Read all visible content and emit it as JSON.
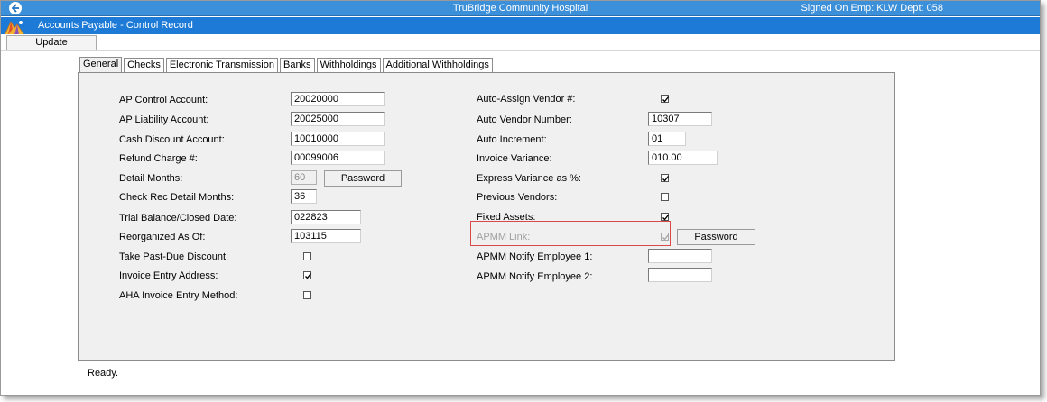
{
  "titlebar": {
    "hospital": "TruBridge Community Hospital",
    "signed_on": "Signed On Emp: KLW  Dept: 058"
  },
  "subbar": {
    "title": "Accounts Payable - Control Record"
  },
  "menu": {
    "update": "Update"
  },
  "tabs": [
    "General",
    "Checks",
    "Electronic Transmission",
    "Banks",
    "Withholdings",
    "Additional Withholdings"
  ],
  "left": {
    "ap_control_account": {
      "label": "AP Control Account:",
      "value": "20020000"
    },
    "ap_liability_account": {
      "label": "AP Liability Account:",
      "value": "20025000"
    },
    "cash_discount_account": {
      "label": "Cash Discount Account:",
      "value": "10010000"
    },
    "refund_charge": {
      "label": "Refund Charge #:",
      "value": "00099006"
    },
    "detail_months": {
      "label": "Detail Months:",
      "value": "60",
      "button": "Password"
    },
    "check_rec_detail_months": {
      "label": "Check Rec Detail Months:",
      "value": "36"
    },
    "trial_balance_closed_date": {
      "label": "Trial Balance/Closed Date:",
      "value": "022823"
    },
    "reorganized_as_of": {
      "label": "Reorganized As Of:",
      "value": "103115"
    },
    "take_past_due_discount": {
      "label": "Take Past-Due Discount:",
      "checked": false
    },
    "invoice_entry_address": {
      "label": "Invoice Entry Address:",
      "checked": true
    },
    "aha_invoice_entry_method": {
      "label": "AHA Invoice Entry Method:",
      "checked": false
    }
  },
  "right": {
    "auto_assign_vendor": {
      "label": "Auto-Assign Vendor #:",
      "checked": true
    },
    "auto_vendor_number": {
      "label": "Auto Vendor Number:",
      "value": "10307"
    },
    "auto_increment": {
      "label": "Auto Increment:",
      "value": "01"
    },
    "invoice_variance": {
      "label": "Invoice Variance:",
      "value": "010.00"
    },
    "express_variance_pct": {
      "label": "Express Variance as %:",
      "checked": true
    },
    "previous_vendors": {
      "label": "Previous Vendors:",
      "checked": false
    },
    "fixed_assets": {
      "label": "Fixed Assets:",
      "checked": true
    },
    "apmm_link": {
      "label": "APMM Link:",
      "checked": true,
      "button": "Password"
    },
    "apmm_notify_employee_1": {
      "label": "APMM Notify Employee 1:",
      "value": ""
    },
    "apmm_notify_employee_2": {
      "label": "APMM Notify Employee 2:",
      "value": ""
    }
  },
  "status": "Ready.",
  "colors": {
    "titlebar": "#3c8fd9",
    "subbar": "#1d7bd7",
    "panel": "#f0f0f0",
    "highlight": "#d84a4a"
  },
  "icons": {
    "back": "back-arrow-icon",
    "logo": "app-logo-icon",
    "check": "checkmark-icon"
  }
}
